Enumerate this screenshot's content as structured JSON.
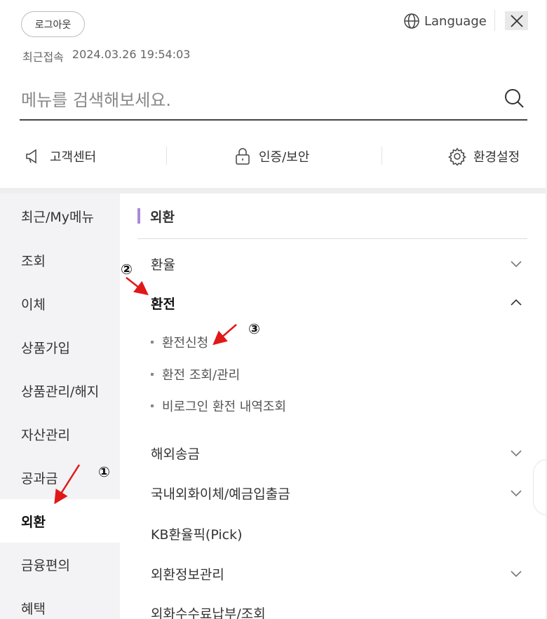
{
  "header": {
    "logout_label": "로그아웃",
    "language_label": "Language",
    "last_login_label": "최근접속",
    "last_login_time": "2024.03.26 19:54:03"
  },
  "search": {
    "placeholder": "메뉴를 검색해보세요."
  },
  "quick_links": [
    {
      "label": "고객센터",
      "icon": "megaphone-icon"
    },
    {
      "label": "인증/보안",
      "icon": "lock-icon"
    },
    {
      "label": "환경설정",
      "icon": "gear-icon"
    }
  ],
  "sidebar": {
    "items": [
      {
        "label": "최근/My메뉴"
      },
      {
        "label": "조회"
      },
      {
        "label": "이체"
      },
      {
        "label": "상품가입"
      },
      {
        "label": "상품관리/해지"
      },
      {
        "label": "자산관리"
      },
      {
        "label": "공과금"
      },
      {
        "label": "외환",
        "active": true
      },
      {
        "label": "금융편의"
      },
      {
        "label": "혜택"
      }
    ]
  },
  "content": {
    "title": "외환",
    "menus": [
      {
        "label": "환율",
        "state": "collapsed"
      },
      {
        "label": "환전",
        "state": "expanded",
        "children": [
          {
            "label": "환전신청"
          },
          {
            "label": "환전 조회/관리"
          },
          {
            "label": "비로그인 환전 내역조회"
          }
        ]
      },
      {
        "label": "해외송금",
        "state": "collapsed"
      },
      {
        "label": "국내외화이체/예금입출금",
        "state": "collapsed"
      },
      {
        "label": "KB환율픽(Pick)"
      },
      {
        "label": "외환정보관리",
        "state": "collapsed"
      },
      {
        "label": "외화수수료납부/조회"
      }
    ]
  },
  "annotations": {
    "step1": "①",
    "step2": "②",
    "step3": "③",
    "arrow_color": "#e01818"
  },
  "colors": {
    "accent_bar": "#a98bd6",
    "sidebar_bg": "#f3f3f5"
  }
}
